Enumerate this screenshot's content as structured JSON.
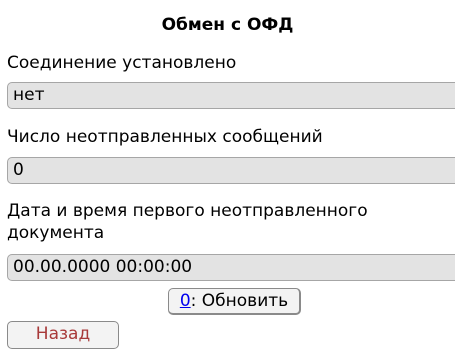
{
  "title": "Обмен с ОФД",
  "fields": [
    {
      "label": "Соединение установлено",
      "value": "нет"
    },
    {
      "label": "Число неотправленных сообщений",
      "value": "0"
    },
    {
      "label": "Дата и время первого неотправленного документа",
      "value": "00.00.0000 00:00:00"
    }
  ],
  "refresh_button": {
    "key": "0",
    "separator": ":",
    "label": " Обновить"
  },
  "back_button": {
    "label": "Назад"
  },
  "colors": {
    "field_background": "#e3e3e3",
    "link_key": "#0000ee",
    "back_text": "#a83a3a"
  }
}
